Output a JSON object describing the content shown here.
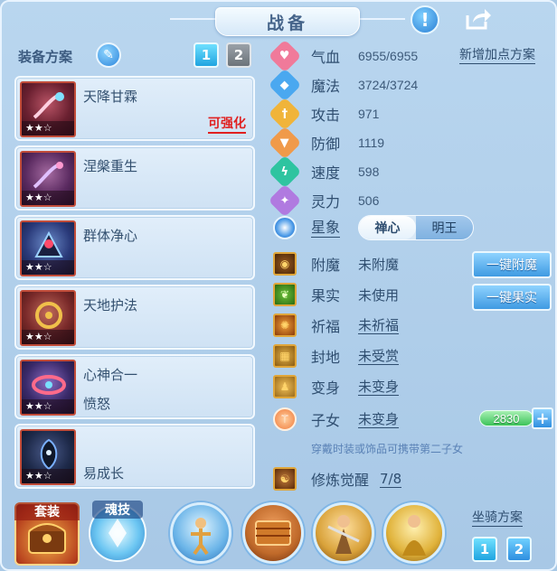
{
  "header": {
    "title": "战备",
    "info_icon": "exclamation-icon",
    "share_icon": "share-icon"
  },
  "equipment": {
    "scheme_label": "装备方案",
    "scheme_tabs": [
      "1",
      "2"
    ],
    "items": [
      {
        "name": "天降甘霖",
        "sub": "",
        "upgrade": "可强化",
        "stars": "★★☆",
        "color": "#c04a6a"
      },
      {
        "name": "涅槃重生",
        "sub": "",
        "upgrade": "",
        "stars": "★★☆",
        "color": "#8a3a6a"
      },
      {
        "name": "群体净心",
        "sub": "",
        "upgrade": "",
        "stars": "★★☆",
        "color": "#3a4a8a"
      },
      {
        "name": "天地护法",
        "sub": "",
        "upgrade": "",
        "stars": "★★☆",
        "color": "#a03a3a"
      },
      {
        "name": "心神合一",
        "sub": "愤怒",
        "upgrade": "",
        "stars": "★★☆",
        "color": "#5a3a8a"
      },
      {
        "name": "",
        "sub": "易成长",
        "upgrade": "",
        "stars": "★★☆",
        "color": "#1e2a4a"
      }
    ]
  },
  "stats": {
    "new_points": "新增加点方案",
    "rows": [
      {
        "name": "气血",
        "value": "6955/6955",
        "icon": "heart-icon",
        "color": "#f07a9a",
        "glyph": "♥"
      },
      {
        "name": "魔法",
        "value": "3724/3724",
        "icon": "mana-icon",
        "color": "#4aa8f0",
        "glyph": "◆"
      },
      {
        "name": "攻击",
        "value": "971",
        "icon": "sword-icon",
        "color": "#f0b43a",
        "glyph": "†"
      },
      {
        "name": "防御",
        "value": "1119",
        "icon": "shield-icon",
        "color": "#f09a4a",
        "glyph": "▼"
      },
      {
        "name": "速度",
        "value": "598",
        "icon": "speed-icon",
        "color": "#2ec4a0",
        "glyph": "ϟ"
      },
      {
        "name": "灵力",
        "value": "506",
        "icon": "spirit-icon",
        "color": "#b07ae0",
        "glyph": "✦"
      }
    ],
    "star_label": "星象",
    "star_options": [
      "禅心",
      "明王"
    ]
  },
  "slots": [
    {
      "name": "附魔",
      "value": "未附魔",
      "link": false,
      "icon": "enchant-icon",
      "glyph": "◉"
    },
    {
      "name": "果实",
      "value": "未使用",
      "link": false,
      "icon": "fruit-icon",
      "glyph": "❦"
    },
    {
      "name": "祈福",
      "value": "未祈福",
      "link": true,
      "icon": "blessing-icon",
      "glyph": "✺"
    },
    {
      "name": "封地",
      "value": "未受赏",
      "link": true,
      "icon": "fief-icon",
      "glyph": "▦"
    },
    {
      "name": "变身",
      "value": "未变身",
      "link": true,
      "icon": "transform-icon",
      "glyph": "♟"
    }
  ],
  "actions": {
    "enchant": "一键附魔",
    "fruit": "一键果实"
  },
  "child": {
    "name": "子女",
    "value": "未变身",
    "points": "2830",
    "icon": "child-icon"
  },
  "hint": "穿戴时装或饰品可携带第二子女",
  "cultivation": {
    "name": "修炼觉醒",
    "value": "7/8",
    "icon": "cultivation-icon"
  },
  "bottom": {
    "suit_label": "套装",
    "soul_label": "魂技",
    "mount_label": "坐骑方案",
    "mount_tabs": [
      "1",
      "2"
    ],
    "mounts": [
      {
        "name": "mount-1",
        "color": "#6ab4e8"
      },
      {
        "name": "mount-2",
        "color": "#c06a2a"
      },
      {
        "name": "mount-3",
        "color": "#d9a23a"
      },
      {
        "name": "mount-4",
        "color": "#e0b23a"
      }
    ]
  }
}
